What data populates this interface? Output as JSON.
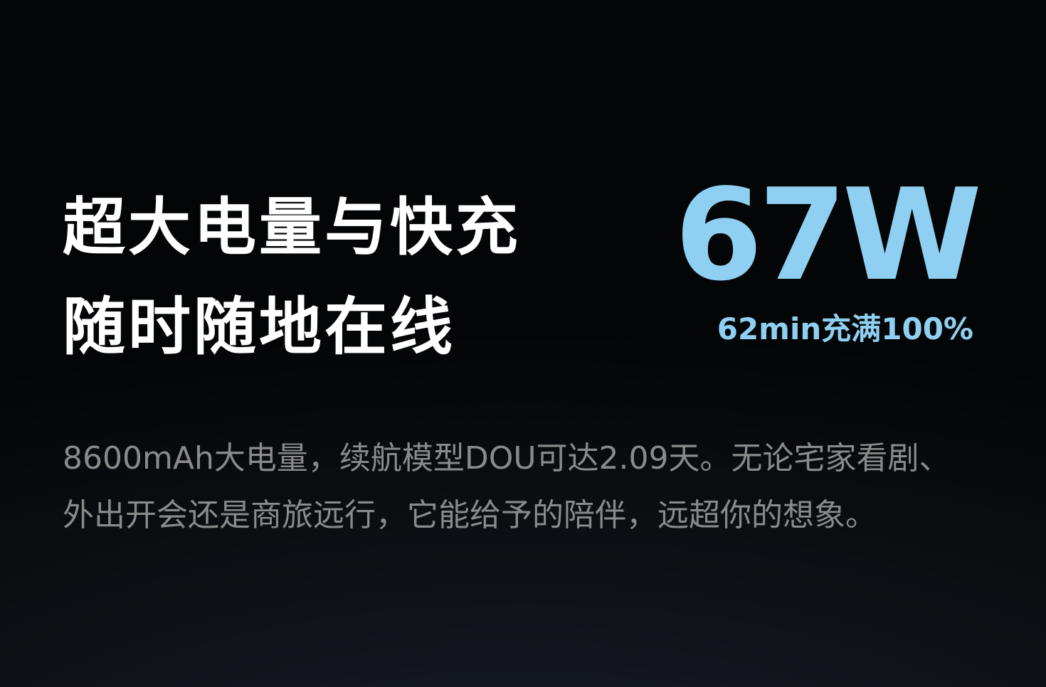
{
  "headline": {
    "line1": "超大电量与快充",
    "line2": "随时随地在线"
  },
  "spec": {
    "value": "67W",
    "subtitle": "62min充满100%"
  },
  "body": {
    "line1": "8600mAh大电量，续航模型DOU可达2.09天。无论宅家看剧、",
    "line2": "外出开会还是商旅远行，它能给予的陪伴，远超你的想象。"
  },
  "colors": {
    "background": "#050607",
    "headline": "#ffffff",
    "accent": "#8fd0f2",
    "body_text": "#8a8a8a"
  }
}
